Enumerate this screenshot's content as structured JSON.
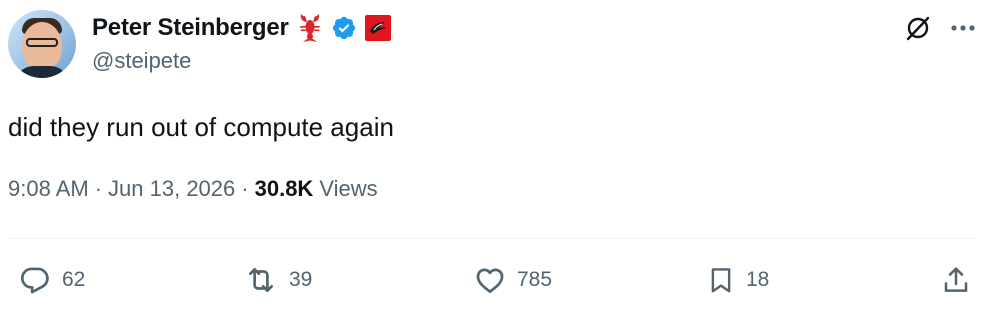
{
  "author": {
    "display_name": "Peter Steinberger",
    "handle": "@steipete",
    "avatar_icon": "profile-photo",
    "badges": [
      "lobster-emoji",
      "verified-badge-icon",
      "red-flag-icon"
    ],
    "verified_color": "#1d9bf0"
  },
  "header_actions": {
    "grok_icon": "grok-icon",
    "more_icon": "more-icon"
  },
  "tweet": {
    "text": "did they run out of compute again"
  },
  "meta": {
    "time": "9:08 AM",
    "sep1": "·",
    "date": "Jun 13, 2026",
    "sep2": "·",
    "views_count": "30.8K",
    "views_label": "Views"
  },
  "actions": {
    "reply_count": "62",
    "retweet_count": "39",
    "like_count": "785",
    "bookmark_count": "18",
    "share_icon": "share-icon"
  },
  "colors": {
    "text": "#0f1419",
    "secondary": "#536471",
    "divider": "#eff3f4"
  }
}
